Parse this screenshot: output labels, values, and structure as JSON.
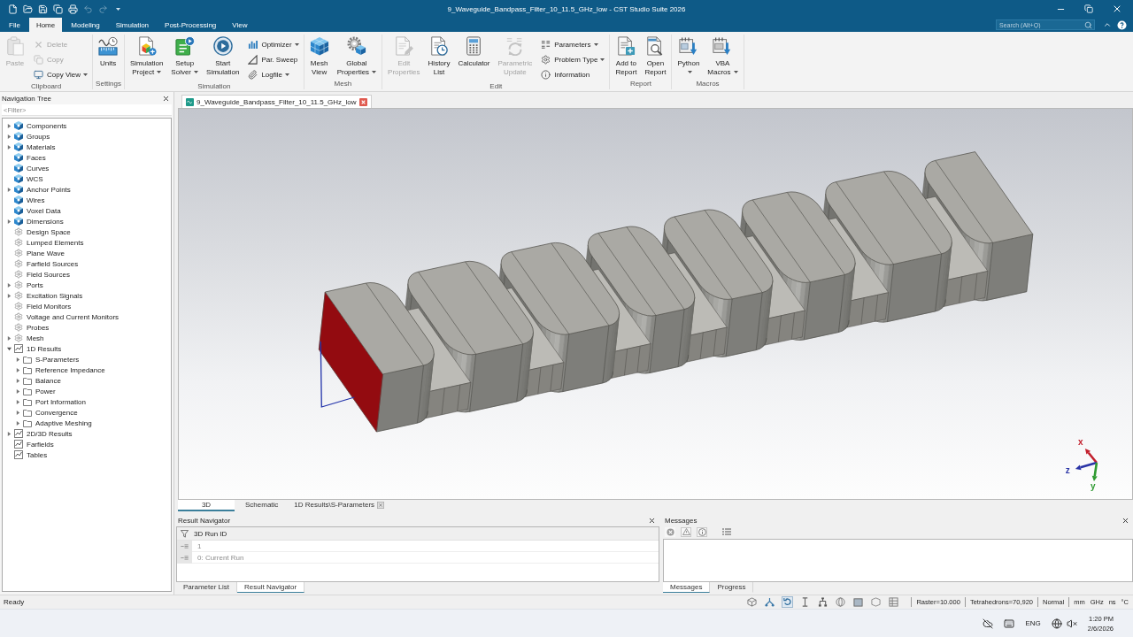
{
  "title_bar": {
    "quick_access": [
      {
        "disabled": false
      },
      {
        "disabled": false
      },
      {
        "disabled": false
      },
      {
        "disabled": false
      },
      {
        "disabled": false
      },
      {
        "disabled": true
      },
      {
        "disabled": true
      }
    ],
    "title": "9_Waveguide_Bandpass_Filter_10_11.5_GHz_low - CST Studio Suite 2026"
  },
  "ribbon_tabs": [
    {
      "label": "File",
      "selected": false
    },
    {
      "label": "Home",
      "selected": true
    },
    {
      "label": "Modeling",
      "selected": false
    },
    {
      "label": "Simulation",
      "selected": false
    },
    {
      "label": "Post-Processing",
      "selected": false
    },
    {
      "label": "View",
      "selected": false
    }
  ],
  "search": {
    "placeholder": "Search (Alt+Q)"
  },
  "ribbon": [
    {
      "label": "Clipboard",
      "items": [
        {
          "kind": "large",
          "lines": [
            "Paste"
          ],
          "dropdown": false,
          "disabled": true
        },
        {
          "kind": "stack",
          "items": [
            {
              "label": "Delete",
              "dropdown": false,
              "disabled": true
            },
            {
              "label": "Copy",
              "dropdown": false,
              "disabled": true
            },
            {
              "label": "Copy View",
              "dropdown": true,
              "disabled": false
            }
          ]
        }
      ]
    },
    {
      "label": "Settings",
      "items": [
        {
          "kind": "large",
          "lines": [
            "Units"
          ],
          "dropdown": false,
          "disabled": false
        }
      ]
    },
    {
      "label": "Simulation",
      "items": [
        {
          "kind": "large",
          "lines": [
            "Simulation",
            "Project"
          ],
          "dropdown": true,
          "disabled": false
        },
        {
          "kind": "large",
          "lines": [
            "Setup",
            "Solver"
          ],
          "dropdown": true,
          "disabled": false
        },
        {
          "kind": "large",
          "lines": [
            "Start",
            "Simulation"
          ],
          "dropdown": false,
          "disabled": false
        },
        {
          "kind": "stack",
          "items": [
            {
              "label": "Optimizer",
              "dropdown": true,
              "disabled": false
            },
            {
              "label": "Par. Sweep",
              "dropdown": false,
              "disabled": false
            },
            {
              "label": "Logfile",
              "dropdown": true,
              "disabled": false
            }
          ]
        }
      ]
    },
    {
      "label": "Mesh",
      "items": [
        {
          "kind": "large",
          "lines": [
            "Mesh",
            "View"
          ],
          "dropdown": false,
          "disabled": false
        },
        {
          "kind": "large",
          "lines": [
            "Global",
            "Properties"
          ],
          "dropdown": true,
          "disabled": false
        }
      ]
    },
    {
      "label": "Edit",
      "items": [
        {
          "kind": "large",
          "lines": [
            "Edit",
            "Properties"
          ],
          "dropdown": false,
          "disabled": true
        },
        {
          "kind": "large",
          "lines": [
            "History",
            "List"
          ],
          "dropdown": false,
          "disabled": false
        },
        {
          "kind": "large",
          "lines": [
            "Calculator"
          ],
          "dropdown": false,
          "disabled": false
        },
        {
          "kind": "large",
          "lines": [
            "Parametric",
            "Update"
          ],
          "dropdown": false,
          "disabled": true
        },
        {
          "kind": "stack",
          "items": [
            {
              "label": "Parameters",
              "dropdown": true,
              "disabled": false
            },
            {
              "label": "Problem Type",
              "dropdown": true,
              "disabled": false
            },
            {
              "label": "Information",
              "dropdown": false,
              "disabled": false
            }
          ]
        }
      ]
    },
    {
      "label": "Report",
      "items": [
        {
          "kind": "large",
          "lines": [
            "Add to",
            "Report"
          ],
          "dropdown": false,
          "disabled": false
        },
        {
          "kind": "large",
          "lines": [
            "Open",
            "Report"
          ],
          "dropdown": false,
          "disabled": false
        }
      ]
    },
    {
      "label": "Macros",
      "items": [
        {
          "kind": "large",
          "lines": [
            "Python"
          ],
          "dropdown": true,
          "disabled": false
        },
        {
          "kind": "large",
          "lines": [
            "VBA",
            "Macros"
          ],
          "dropdown": true,
          "disabled": false
        }
      ]
    }
  ],
  "navigation_tree": {
    "title": "Navigation Tree",
    "filter": {
      "placeholder": "<Filter>"
    },
    "items": [
      {
        "kind": "model",
        "label": "Components",
        "expandable": true,
        "expanded": false
      },
      {
        "kind": "model",
        "label": "Groups",
        "expandable": true,
        "expanded": false
      },
      {
        "kind": "model",
        "label": "Materials",
        "expandable": true,
        "expanded": false
      },
      {
        "kind": "model",
        "label": "Faces",
        "expandable": false,
        "expanded": false
      },
      {
        "kind": "model",
        "label": "Curves",
        "expandable": false,
        "expanded": false
      },
      {
        "kind": "model",
        "label": "WCS",
        "expandable": false,
        "expanded": false
      },
      {
        "kind": "model",
        "label": "Anchor Points",
        "expandable": true,
        "expanded": false
      },
      {
        "kind": "model",
        "label": "Wires",
        "expandable": false,
        "expanded": false
      },
      {
        "kind": "model",
        "label": "Voxel Data",
        "expandable": false,
        "expanded": false
      },
      {
        "kind": "model",
        "label": "Dimensions",
        "expandable": true,
        "expanded": false
      },
      {
        "kind": "setup",
        "label": "Design Space",
        "expandable": false,
        "expanded": false
      },
      {
        "kind": "setup",
        "label": "Lumped Elements",
        "expandable": false,
        "expanded": false
      },
      {
        "kind": "setup",
        "label": "Plane Wave",
        "expandable": false,
        "expanded": false
      },
      {
        "kind": "setup",
        "label": "Farfield Sources",
        "expandable": false,
        "expanded": false
      },
      {
        "kind": "setup",
        "label": "Field Sources",
        "expandable": false,
        "expanded": false
      },
      {
        "kind": "setup",
        "label": "Ports",
        "expandable": true,
        "expanded": false
      },
      {
        "kind": "setup",
        "label": "Excitation Signals",
        "expandable": true,
        "expanded": false
      },
      {
        "kind": "setup",
        "label": "Field Monitors",
        "expandable": false,
        "expanded": false
      },
      {
        "kind": "setup",
        "label": "Voltage and Current Monitors",
        "expandable": false,
        "expanded": false
      },
      {
        "kind": "setup",
        "label": "Probes",
        "expandable": false,
        "expanded": false
      },
      {
        "kind": "setup",
        "label": "Mesh",
        "expandable": true,
        "expanded": false
      },
      {
        "kind": "results",
        "label": "1D Results",
        "expandable": true,
        "expanded": true,
        "children": [
          {
            "kind": "folder",
            "label": "S-Parameters",
            "expandable": true,
            "expanded": false
          },
          {
            "kind": "folder",
            "label": "Reference Impedance",
            "expandable": true,
            "expanded": false
          },
          {
            "kind": "folder",
            "label": "Balance",
            "expandable": true,
            "expanded": false
          },
          {
            "kind": "folder",
            "label": "Power",
            "expandable": true,
            "expanded": false
          },
          {
            "kind": "folder",
            "label": "Port Information",
            "expandable": true,
            "expanded": false
          },
          {
            "kind": "folder",
            "label": "Convergence",
            "expandable": true,
            "expanded": false
          },
          {
            "kind": "folder",
            "label": "Adaptive Meshing",
            "expandable": true,
            "expanded": false
          }
        ]
      },
      {
        "kind": "results",
        "label": "2D/3D Results",
        "expandable": true,
        "expanded": false
      },
      {
        "kind": "results",
        "label": "Farfields",
        "expandable": false,
        "expanded": false
      },
      {
        "kind": "results",
        "label": "Tables",
        "expandable": false,
        "expanded": false
      }
    ]
  },
  "document_tabs": [
    {
      "label": "9_Waveguide_Bandpass_Filter_10_11.5_GHz_low",
      "selected": true
    }
  ],
  "view": {
    "triad": [
      {
        "kind": "x",
        "label": "x",
        "color": "#c21f2c"
      },
      {
        "kind": "z",
        "label": "z",
        "color": "#2a34a6"
      },
      {
        "kind": "y",
        "label": "y",
        "color": "#2f9a31"
      }
    ]
  },
  "view_tabs": [
    {
      "label": "3D",
      "selected": true,
      "closable": false
    },
    {
      "label": "Schematic",
      "selected": false,
      "closable": false
    },
    {
      "label": "1D Results\\S-Parameters",
      "selected": false,
      "closable": true
    }
  ],
  "result_navigator": {
    "title": "Result Navigator",
    "column": "3D Run ID",
    "rows": [
      "1",
      "0: Current Run"
    ],
    "tabs": [
      {
        "label": "Parameter List",
        "selected": false
      },
      {
        "label": "Result Navigator",
        "selected": true
      }
    ]
  },
  "messages": {
    "title": "Messages",
    "tabs": [
      {
        "label": "Messages",
        "selected": true
      },
      {
        "label": "Progress",
        "selected": false
      }
    ]
  },
  "status_bar": {
    "text": "Ready",
    "fields": [
      "Raster=10.000",
      "Tetrahedrons=70,920",
      "Normal"
    ],
    "units": [
      "mm",
      "GHz",
      "ns",
      "°C"
    ]
  },
  "taskbar": {
    "language": "ENG",
    "time": "1:20 PM",
    "date": "2/6/2026"
  }
}
